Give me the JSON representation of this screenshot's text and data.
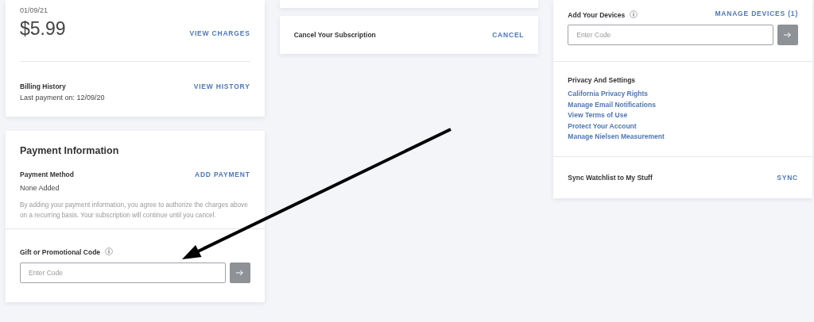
{
  "billing": {
    "date": "01/09/21",
    "amount": "$5.99",
    "view_charges": "VIEW CHARGES",
    "history_title": "Billing History",
    "last_payment": "Last payment on: 12/09/20",
    "view_history": "VIEW HISTORY"
  },
  "payment": {
    "title": "Payment Information",
    "method_label": "Payment Method",
    "method_value": "None Added",
    "add_payment": "ADD PAYMENT",
    "disclaimer": "By adding your payment information, you agree to authorize the charges above on a recurring basis. Your subscription will continue until you cancel.",
    "promo_label": "Gift or Promotional Code",
    "promo_field": {
      "placeholder": "Enter Code"
    }
  },
  "subscription": {
    "label": "Cancel Your Subscription",
    "action": "CANCEL"
  },
  "devices": {
    "label": "Add Your Devices",
    "manage": "MANAGE DEVICES (1)",
    "code_field": {
      "placeholder": "Enter Code"
    }
  },
  "privacy": {
    "title": "Privacy And Settings",
    "links": [
      "California Privacy Rights",
      "Manage Email Notifications",
      "View Terms of Use",
      "Protect Your Account",
      "Manage Nielsen Measurement"
    ]
  },
  "sync": {
    "label": "Sync Watchlist to My Stuff",
    "action": "SYNC"
  }
}
